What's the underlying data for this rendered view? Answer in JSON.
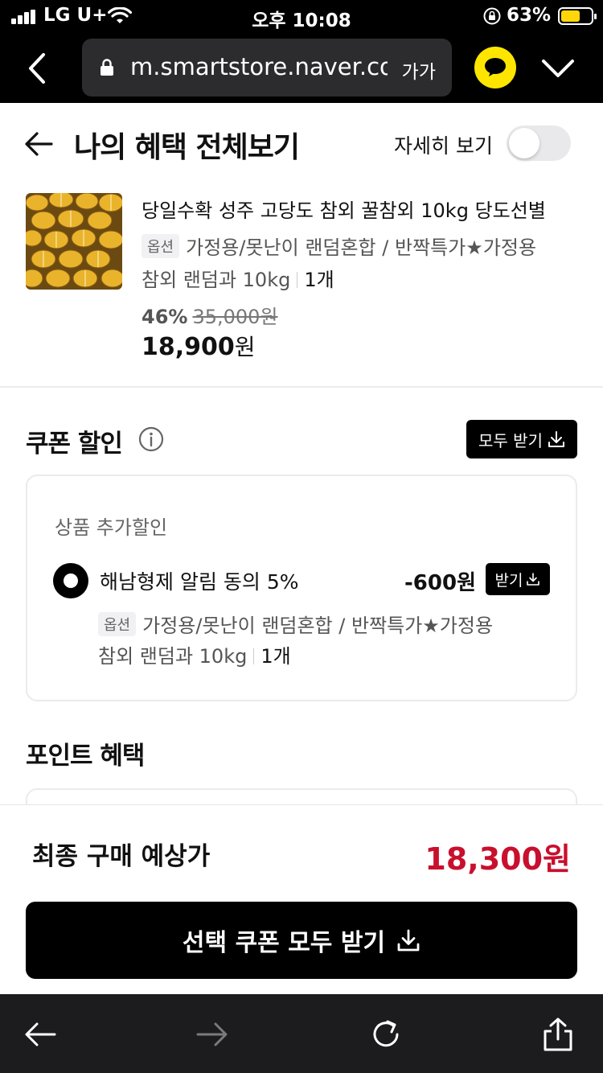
{
  "status_bar": {
    "carrier": "LG U+",
    "time": "오후 10:08",
    "battery": "63%",
    "battery_level": 0.63,
    "battery_color": "#FFD60A"
  },
  "browser": {
    "url": "m.smartstore.naver.com",
    "font_size_button": "가가"
  },
  "header": {
    "title": "나의 혜택 전체보기",
    "detail_toggle_label": "자세히 보기",
    "detail_toggle_on": false
  },
  "product": {
    "title": "당일수확 성주 고당도 참외 꿀참외 10kg 당도선별",
    "option_tag": "옵션",
    "option_line1": "가정용/못난이 랜덤혼합 / 반짝특가★가정용",
    "option_line2": "참외 랜덤과 10kg",
    "quantity": "1개",
    "discount_pct": "46%",
    "original_price": "35,000원",
    "price_number": "18,900",
    "price_unit": "원"
  },
  "coupon": {
    "section_title": "쿠폰 할인",
    "download_all": "모두 받기",
    "card_subtitle": "상품 추가할인",
    "item_name": "해남형제 알림 동의 5%",
    "item_amount": "-600원",
    "item_button": "받기",
    "option_tag": "옵션",
    "option_line1": "가정용/못난이 랜덤혼합 / 반짝특가★가정용",
    "option_line2": "참외 랜덤과 10kg",
    "quantity": "1개"
  },
  "points": {
    "section_title": "포인트 혜택"
  },
  "summary": {
    "final_label": "최종 구매 예상가",
    "final_price": "18,300원",
    "final_price_color": "#C8102E",
    "cta_label": "선택 쿠폰 모두 받기"
  }
}
